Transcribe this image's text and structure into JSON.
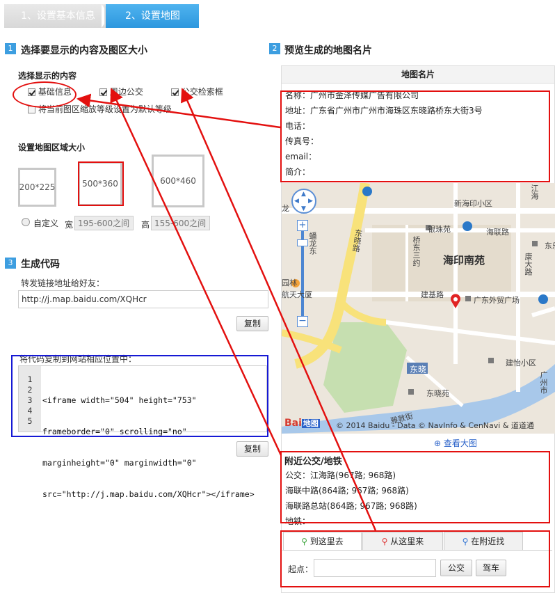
{
  "steps": {
    "step1": "1、设置基本信息",
    "step2": "2、设置地图"
  },
  "section1": {
    "num": "1",
    "title": "选择要显示的内容及图区大小",
    "content_title": "选择显示的内容",
    "checkboxes": {
      "basic": "基础信息",
      "bus_near": "周边公交",
      "bus_search": "公交检索框",
      "zoom_default": "将当前图区缩放等级设置为默认等级"
    },
    "size_title": "设置地图区域大小",
    "sizes": {
      "small": "200*225",
      "medium": "500*360",
      "large": "600*460"
    },
    "custom_label": "自定义",
    "width_label": "宽",
    "width_placeholder": "195-600之间",
    "height_label": "高",
    "height_placeholder": "155-600之间"
  },
  "section2": {
    "num": "2",
    "title": "预览生成的地图名片",
    "card_title": "地图名片",
    "info": {
      "name": "名称：广州市金泽传媒广告有限公司",
      "address": "地址：广东省广州市广州市海珠区东晓路桥东大街3号",
      "phone": "电话：",
      "fax": "传真号：",
      "email": "email：",
      "intro": "简介："
    },
    "map": {
      "labels": {
        "xinhai": "新海印小区",
        "jiangnan": "江海",
        "yinzhu": "银珠苑",
        "haiyin_road": "海联路",
        "qiaodong": "桥东三约",
        "haiyin_nanyuan": "海印南苑",
        "kangda": "康大路",
        "dongxiao": "东晓路",
        "jianji": "建基路",
        "waimao": "广东外贸广场",
        "guangzhou": "广州市",
        "jianbai": "建怡小区",
        "dongxiao_station": "东晓",
        "dongxiao_yuan": "东晓苑",
        "duanhe": "雅敦街",
        "longfeng": "蟠龙东",
        "hangtian": "航天大厦",
        "yuanlin": "园林",
        "dong": "东",
        "long": "龙",
        "dongle": "东乐",
        "qu": "区",
        "dong_edge": "东",
        "jingtang": "聚",
        "dongqu": "区",
        "suluo": "路"
      },
      "copyright": "© 2014 Baidu - Data © NavInfo & CenNavi & 道道通",
      "baidu_logo": "Bai",
      "baidu_logo2": "地图",
      "view_big": "查看大图"
    },
    "transit": {
      "title": "附近公交/地铁",
      "bus": "公交：江海路(967路; 968路)",
      "stop2": "海联中路(864路; 967路; 968路)",
      "stop3": "海联路总站(864路; 967路; 968路)",
      "metro": "地铁："
    },
    "route": {
      "tab_go": "到这里去",
      "tab_from": "从这里来",
      "tab_near": "在附近找",
      "start_label": "起点：",
      "bus_btn": "公交",
      "car_btn": "驾车"
    }
  },
  "section3": {
    "num": "3",
    "title": "生成代码",
    "link_label": "转发链接地址给好友：",
    "link_value": "http://j.map.baidu.com/XQHcr",
    "copy_btn": "复制",
    "embed_label": "将代码复制到网站相应位置中：",
    "code_lines": [
      "<iframe width=\"504\" height=\"753\"",
      "frameborder=\"0\" scrolling=\"no\"",
      "marginheight=\"0\" marginwidth=\"0\"",
      "src=\"http://j.map.baidu.com/XQHcr\"></iframe>",
      ""
    ],
    "line_numbers": [
      "1",
      "2",
      "3",
      "4",
      "5"
    ],
    "copy_btn2": "复制"
  },
  "colors": {
    "accent": "#3d9ee0",
    "annotation_red": "#e3100f",
    "annotation_blue": "#1619d4"
  }
}
